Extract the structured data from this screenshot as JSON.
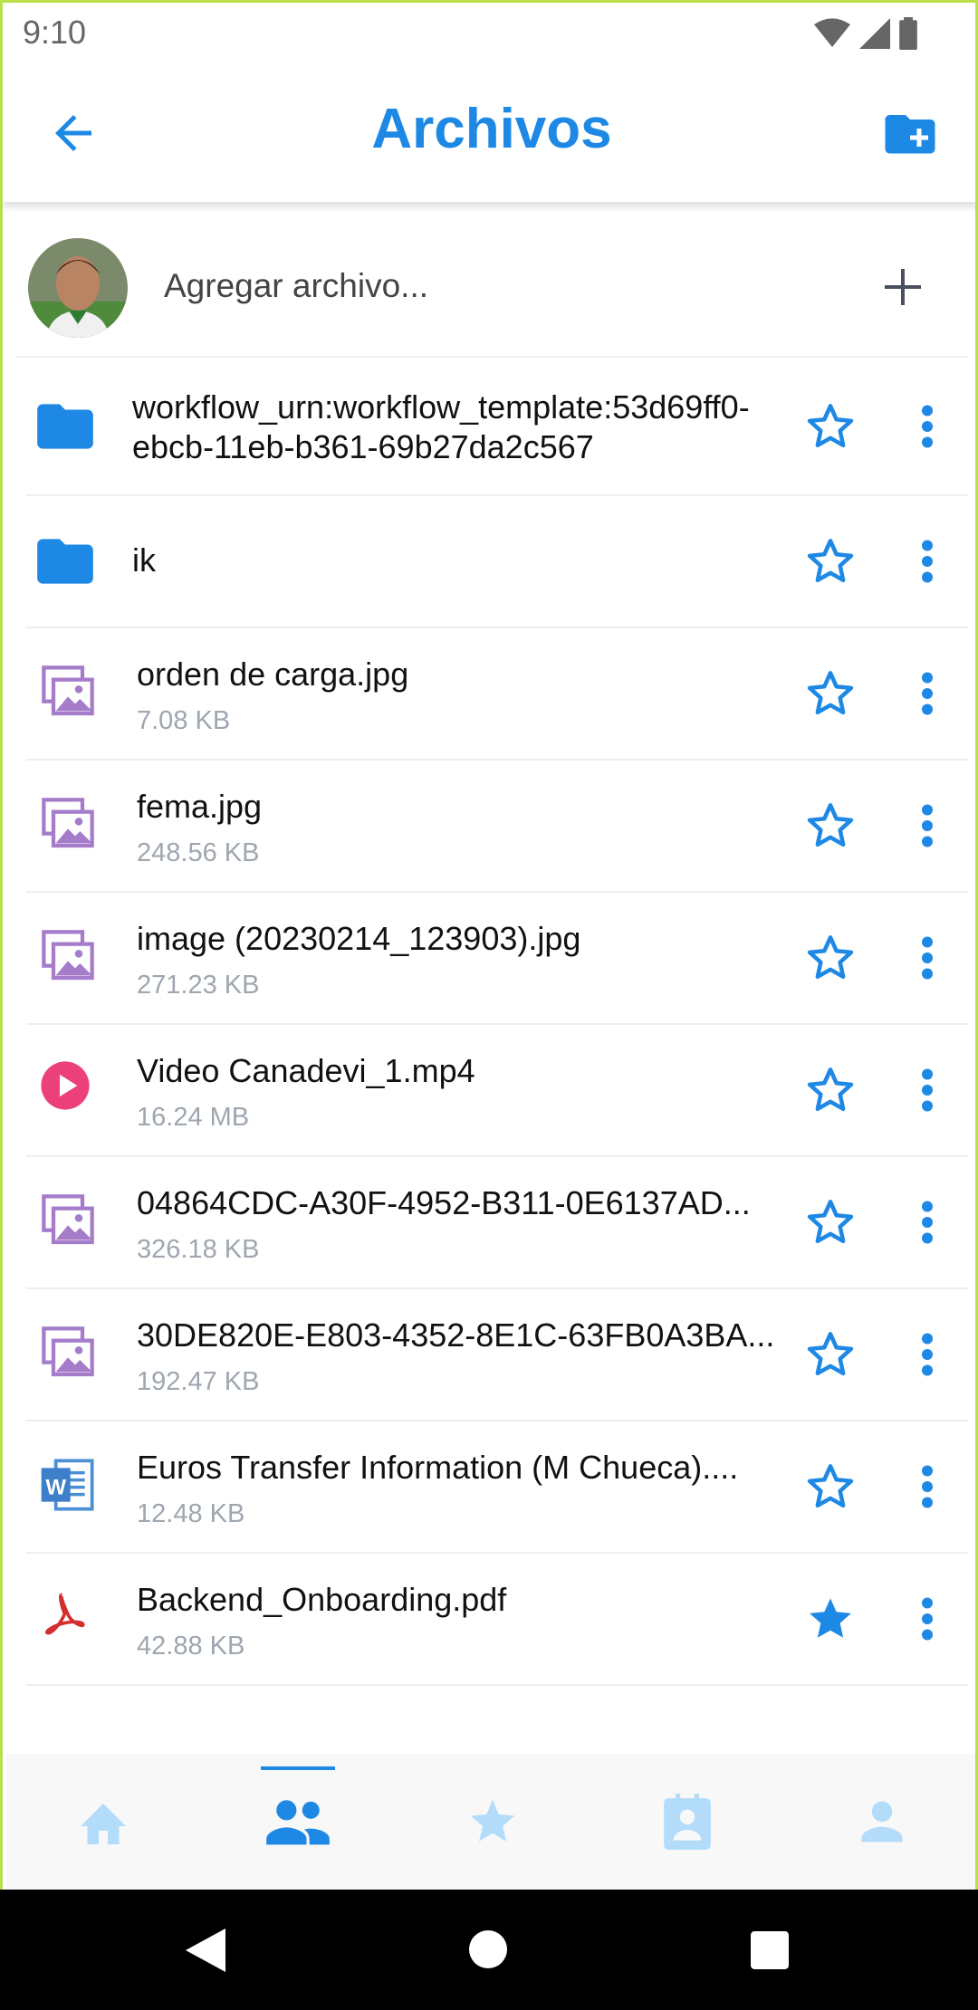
{
  "status_bar": {
    "time": "9:10"
  },
  "header": {
    "title": "Archivos",
    "back_icon": "arrow-back-icon",
    "action_icon": "create-new-folder-icon"
  },
  "add_file": {
    "label": "Agregar archivo...",
    "icon": "plus-icon"
  },
  "files": [
    {
      "name": "workflow_urn:workflow_template:53d69ff0-ebcb-11eb-b361-69b27da2c567",
      "size": "",
      "type": "folder",
      "starred": false
    },
    {
      "name": "ik",
      "size": "",
      "type": "folder",
      "starred": false
    },
    {
      "name": "orden de carga.jpg",
      "size": "7.08 KB",
      "type": "image",
      "starred": false
    },
    {
      "name": "fema.jpg",
      "size": "248.56 KB",
      "type": "image",
      "starred": false
    },
    {
      "name": "image (20230214_123903).jpg",
      "size": "271.23 KB",
      "type": "image",
      "starred": false
    },
    {
      "name": "Video Canadevi_1.mp4",
      "size": "16.24 MB",
      "type": "video",
      "starred": false
    },
    {
      "name": "04864CDC-A30F-4952-B311-0E6137AD...",
      "size": "326.18 KB",
      "type": "image",
      "starred": false
    },
    {
      "name": "30DE820E-E803-4352-8E1C-63FB0A3BA...",
      "size": "192.47 KB",
      "type": "image",
      "starred": false
    },
    {
      "name": "Euros Transfer Information (M Chueca)....",
      "size": "12.48 KB",
      "type": "word",
      "starred": false
    },
    {
      "name": "Backend_Onboarding.pdf",
      "size": "42.88 KB",
      "type": "pdf",
      "starred": true
    }
  ],
  "bottom_nav": {
    "items": [
      "home-icon",
      "group-icon",
      "star-icon",
      "contact-badge-icon",
      "person-icon"
    ],
    "active_index": 1
  },
  "colors": {
    "accent": "#1e88e5",
    "nav_inactive": "#b3dcfa",
    "image_icon": "#a57cc9",
    "video_icon": "#ec407a",
    "pdf_icon": "#d32f2f",
    "word_icon": "#4a8fd3"
  }
}
